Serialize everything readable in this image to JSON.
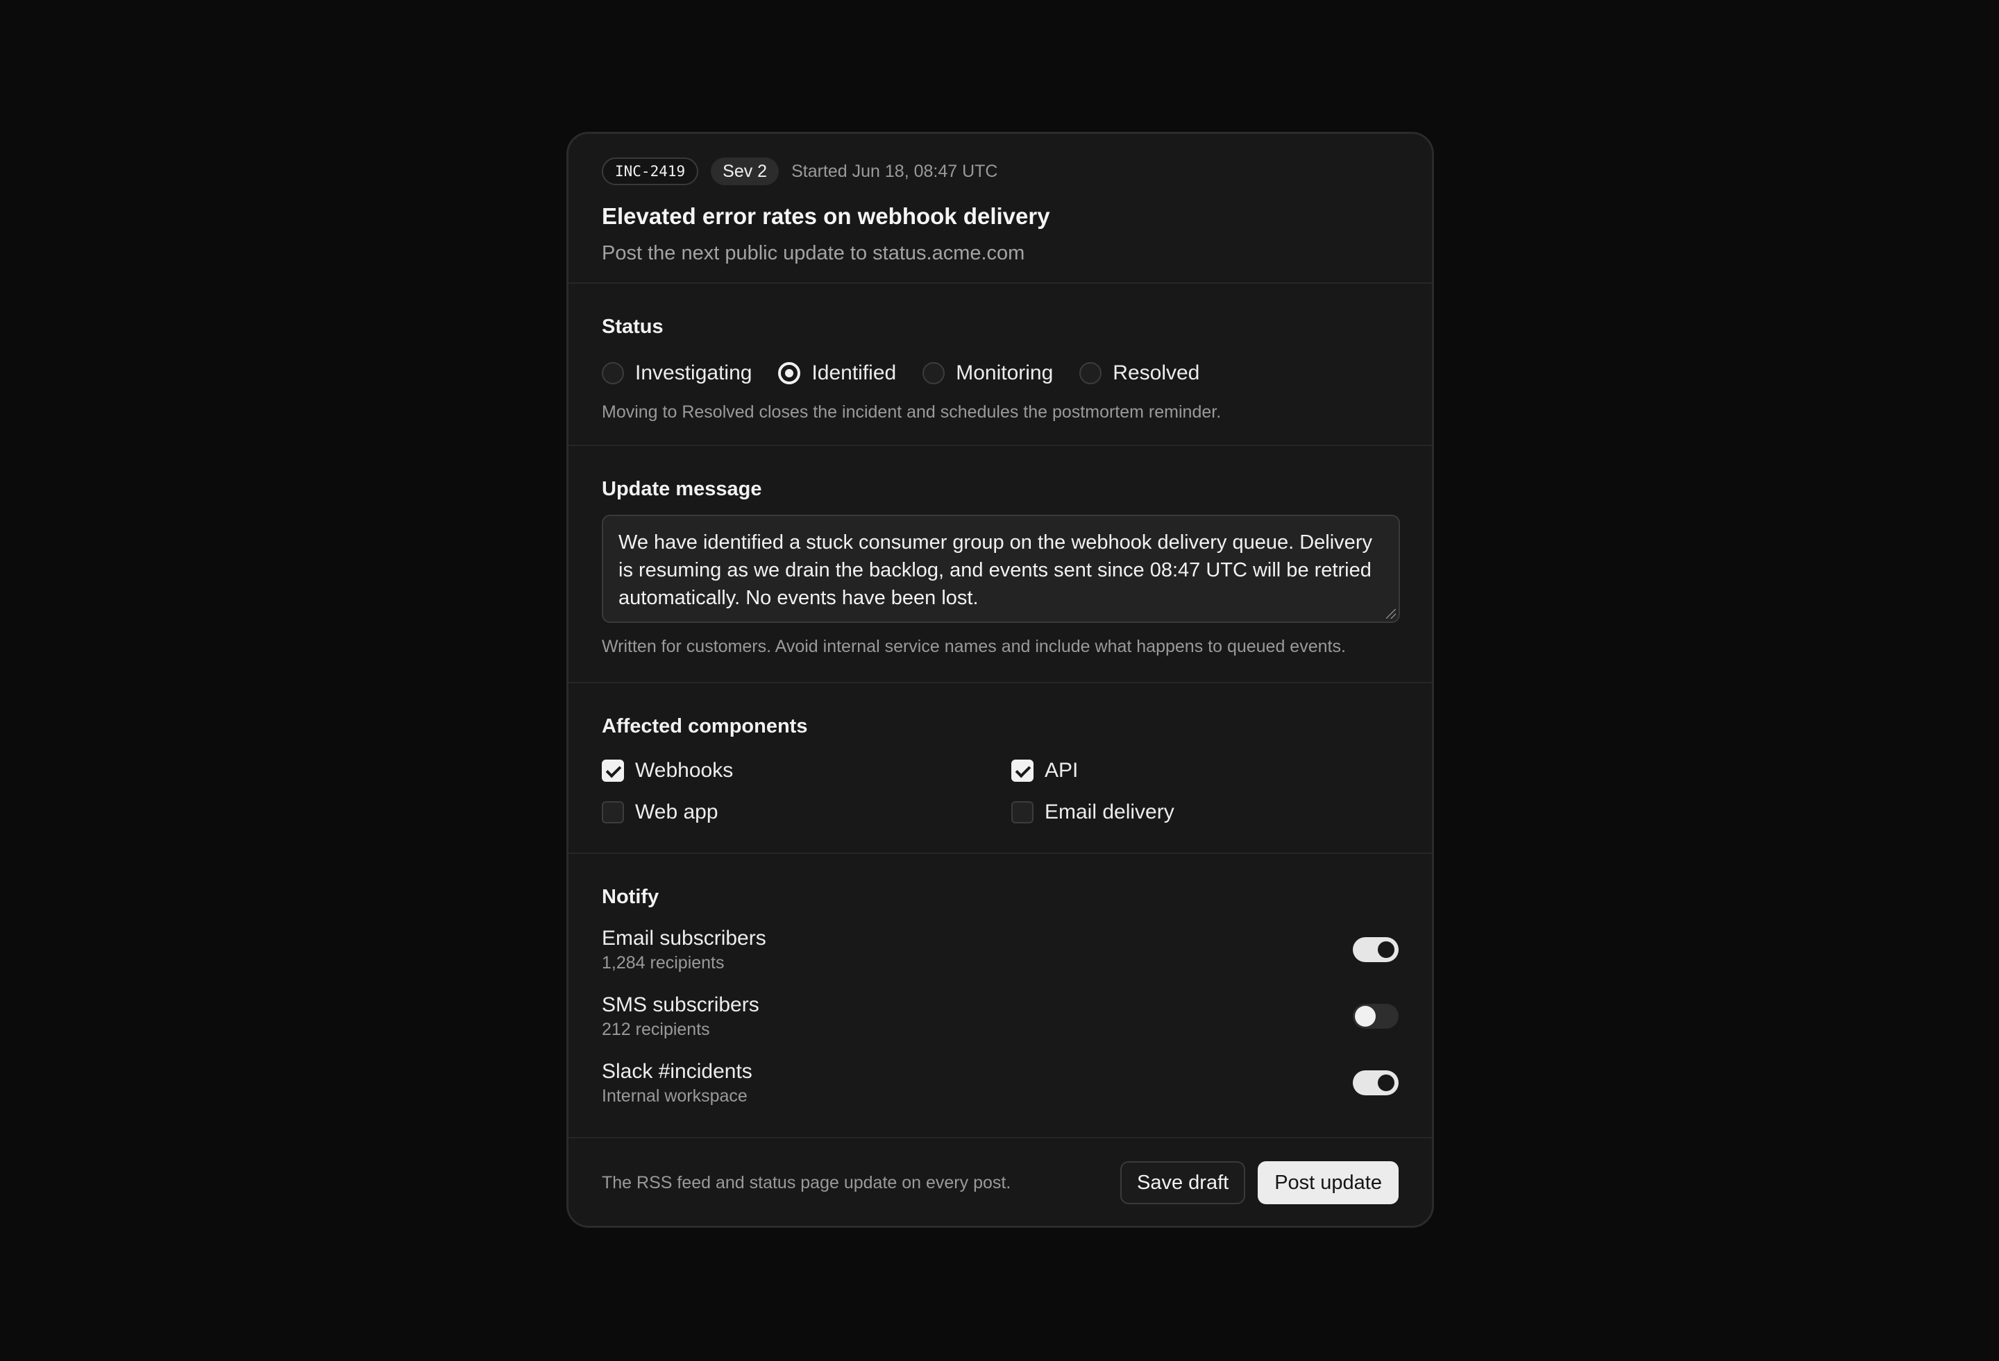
{
  "incident": {
    "id": "INC-2419",
    "severity": "Sev 2",
    "started": "Started Jun 18, 08:47 UTC",
    "title": "Elevated error rates on webhook delivery",
    "subtitle": "Post the next public update to status.acme.com"
  },
  "status": {
    "label": "Status",
    "options": [
      {
        "label": "Investigating",
        "selected": false
      },
      {
        "label": "Identified",
        "selected": true
      },
      {
        "label": "Monitoring",
        "selected": false
      },
      {
        "label": "Resolved",
        "selected": false
      }
    ],
    "hint": "Moving to Resolved closes the incident and schedules the postmortem reminder."
  },
  "message": {
    "label": "Update message",
    "value": "We have identified a stuck consumer group on the webhook delivery queue. Delivery is resuming as we drain the backlog, and events sent since 08:47 UTC will be retried automatically. No events have been lost.",
    "hint": "Written for customers. Avoid internal service names and include what happens to queued events."
  },
  "components": {
    "label": "Affected components",
    "items": [
      {
        "label": "Webhooks",
        "checked": true
      },
      {
        "label": "API",
        "checked": true
      },
      {
        "label": "Web app",
        "checked": false
      },
      {
        "label": "Email delivery",
        "checked": false
      }
    ]
  },
  "notify": {
    "label": "Notify",
    "channels": [
      {
        "title": "Email subscribers",
        "sub": "1,284 recipients",
        "on": true
      },
      {
        "title": "SMS subscribers",
        "sub": "212 recipients",
        "on": false
      },
      {
        "title": "Slack #incidents",
        "sub": "Internal workspace",
        "on": true
      }
    ]
  },
  "footer": {
    "hint": "The RSS feed and status page update on every post.",
    "save_label": "Save draft",
    "post_label": "Post update"
  }
}
